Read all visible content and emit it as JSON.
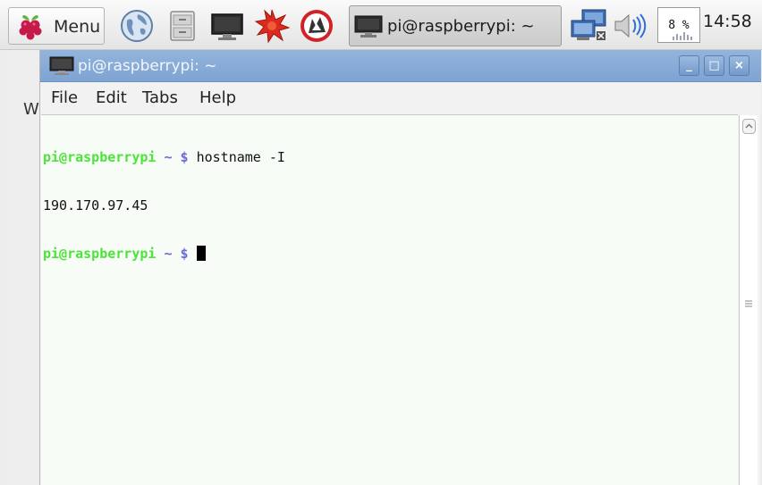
{
  "taskbar": {
    "menu_label": "Menu",
    "launchers": [
      {
        "icon": "web-browser-icon"
      },
      {
        "icon": "file-manager-icon"
      },
      {
        "icon": "terminal-icon"
      },
      {
        "icon": "mathematica-icon"
      },
      {
        "icon": "wolfram-icon"
      }
    ],
    "task_button_label": "pi@raspberrypi: ~",
    "tray": {
      "network_icon": "network-icon",
      "volume_icon": "volume-icon",
      "cpu_usage": "8 %",
      "clock": "14:58"
    }
  },
  "background_window": {
    "visible_letter": "W"
  },
  "terminal": {
    "title": "pi@raspberrypi: ~",
    "window_buttons": {
      "minimize": "_",
      "maximize": "□",
      "close": "×"
    },
    "menu": [
      "File",
      "Edit",
      "Tabs",
      "Help"
    ],
    "lines": [
      {
        "user": "pi@raspberrypi",
        "path": " ~ $",
        "command": " hostname -I"
      },
      {
        "output": "190.170.97.45"
      },
      {
        "user": "pi@raspberrypi",
        "path": " ~ $",
        "command": " "
      }
    ]
  },
  "colors": {
    "title_bar": "#85a9d6",
    "prompt_user": "#4ee33a",
    "prompt_path": "#6a6ad8",
    "terminal_bg": "#f7fcf7"
  }
}
